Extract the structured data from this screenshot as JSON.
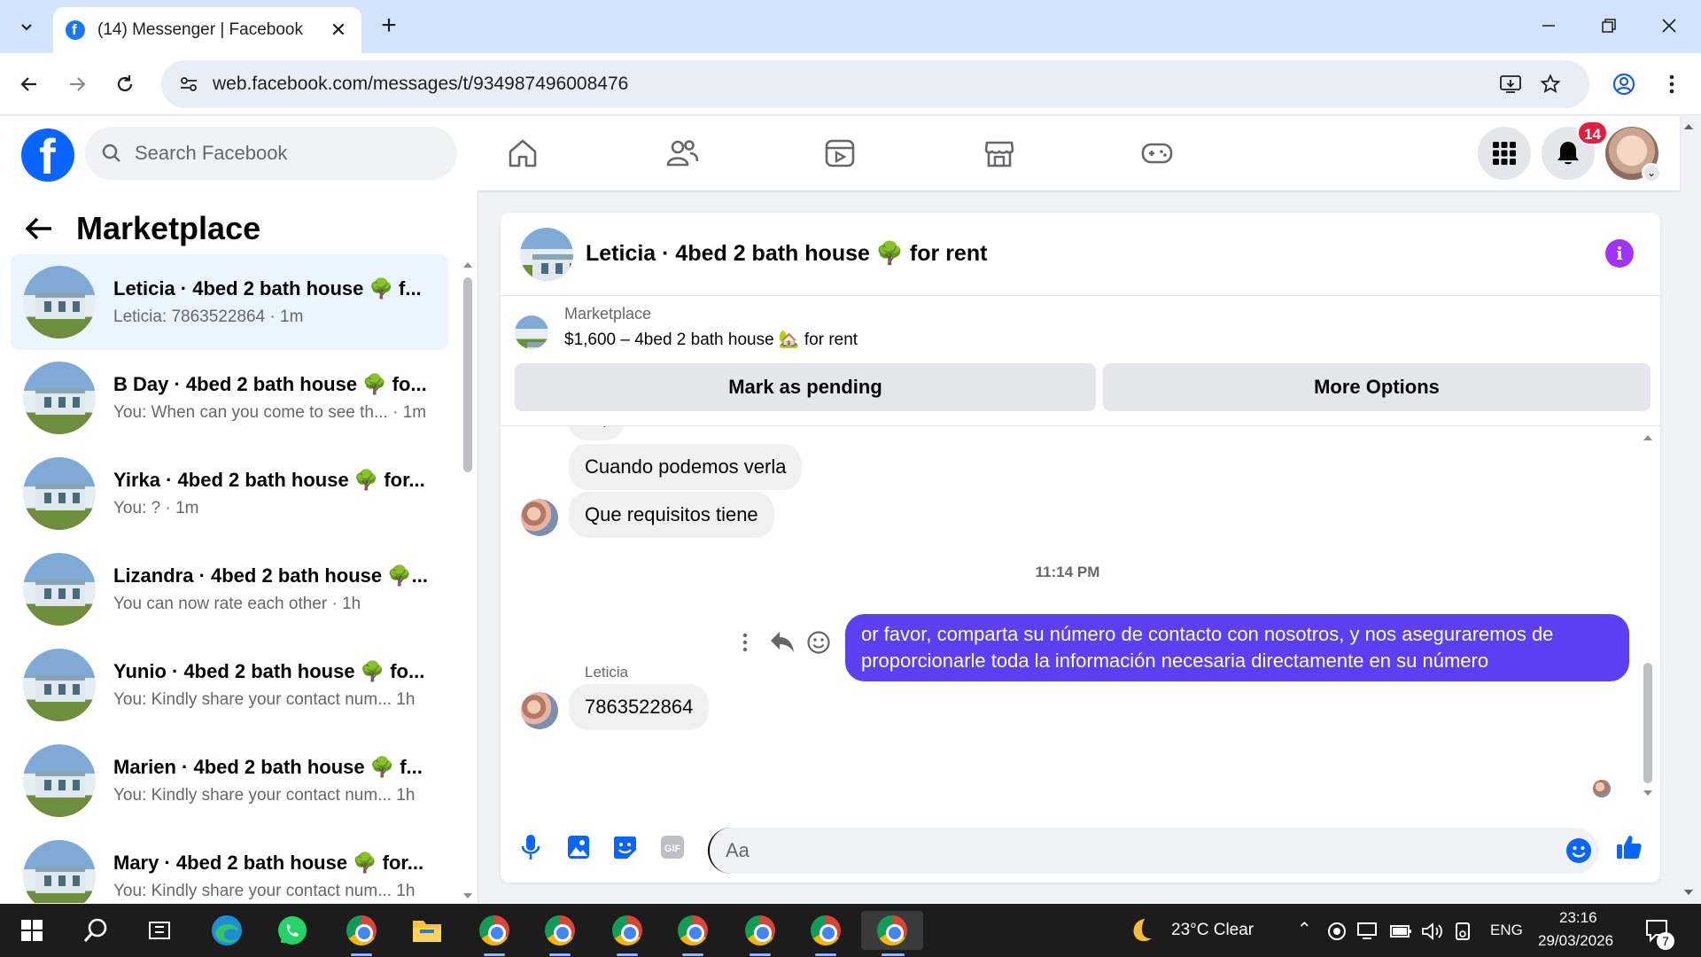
{
  "browser": {
    "tab_title": "(14) Messenger | Facebook",
    "url": "web.facebook.com/messages/t/934987496008476"
  },
  "fb": {
    "search_placeholder": "Search Facebook",
    "notification_count": "14"
  },
  "sidebar": {
    "title": "Marketplace",
    "conversations": [
      {
        "title": "Leticia · 4bed 2 bath house 🌳 f...",
        "subtitle": "Leticia: 7863522864 · 1m"
      },
      {
        "title": "B Day · 4bed 2 bath house 🌳 fo...",
        "subtitle": "You: When can you come to see th... · 1m"
      },
      {
        "title": "Yirka · 4bed 2 bath house 🌳 for...",
        "subtitle": "You: ? · 1m"
      },
      {
        "title": "Lizandra · 4bed 2 bath house 🌳...",
        "subtitle": "You can now rate each other · 1h"
      },
      {
        "title": "Yunio · 4bed 2 bath house 🌳 fo...",
        "subtitle": "You: Kindly share your contact num...  1h"
      },
      {
        "title": "Marien · 4bed 2 bath house 🌳 f...",
        "subtitle": "You: Kindly share your contact num...  1h"
      },
      {
        "title": "Mary · 4bed 2 bath house 🌳 for...",
        "subtitle": "You: Kindly share your contact num...  1h"
      }
    ]
  },
  "chat": {
    "title": "Leticia · 4bed 2 bath house 🌳 for rent",
    "marketplace_label": "Marketplace",
    "listing": "$1,600 – 4bed 2 bath house 🏡 for rent",
    "mark_pending": "Mark as pending",
    "more_options": "More Options",
    "partial_msg": "Si,",
    "msg1": "Cuando podemos verla",
    "msg2": "Que requisitos tiene",
    "timestamp": "11:14 PM",
    "outgoing": "or favor, comparta su número de contacto con nosotros, y nos aseguraremos de proporcionarle toda la información necesaria directamente en su número",
    "sender": "Leticia",
    "msg3": "7863522864",
    "composer_placeholder": "Aa"
  },
  "taskbar": {
    "weather": "23°C  Clear",
    "lang": "ENG",
    "time": "23:16",
    "date": "29/03/2026",
    "notif": "7"
  },
  "colors": {
    "fb_blue": "#0866ff",
    "outgoing_bubble": "#5b3ff0",
    "active_conv": "#ebf5ff",
    "badge": "#e41e3f"
  }
}
